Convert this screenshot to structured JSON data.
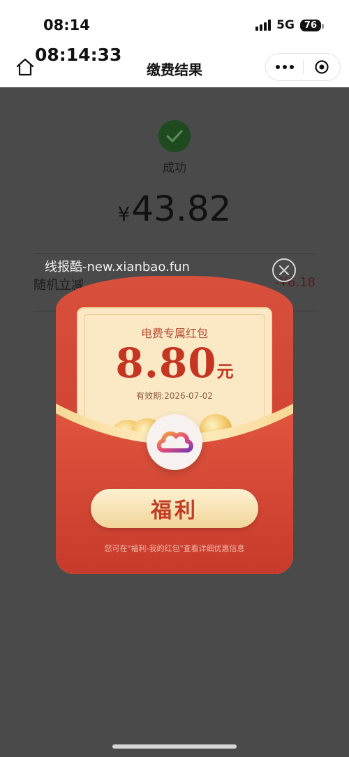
{
  "status_bar": {
    "time": "08:14",
    "network": "5G",
    "battery": "76"
  },
  "nav": {
    "clock_overlay": "08:14:33",
    "title": "缴费结果"
  },
  "result": {
    "status": "成功",
    "currency": "¥",
    "amount": "43.82",
    "discount_label": "随机立减",
    "discount_value": "-¥6.18"
  },
  "watermark": "线报酷-new.xianbao.fun",
  "red_packet": {
    "title": "电费专属红包",
    "amount": "8.80",
    "unit": "元",
    "expiry": "有效期:2026-07-02",
    "button_label": "福利",
    "hint": "您可在\"福利-我的红包\"查看详细优惠信息"
  },
  "colors": {
    "envelope": "#d04436",
    "card": "#fbe9c6",
    "accent_red": "#c43522",
    "success_green": "#1f4a20"
  }
}
